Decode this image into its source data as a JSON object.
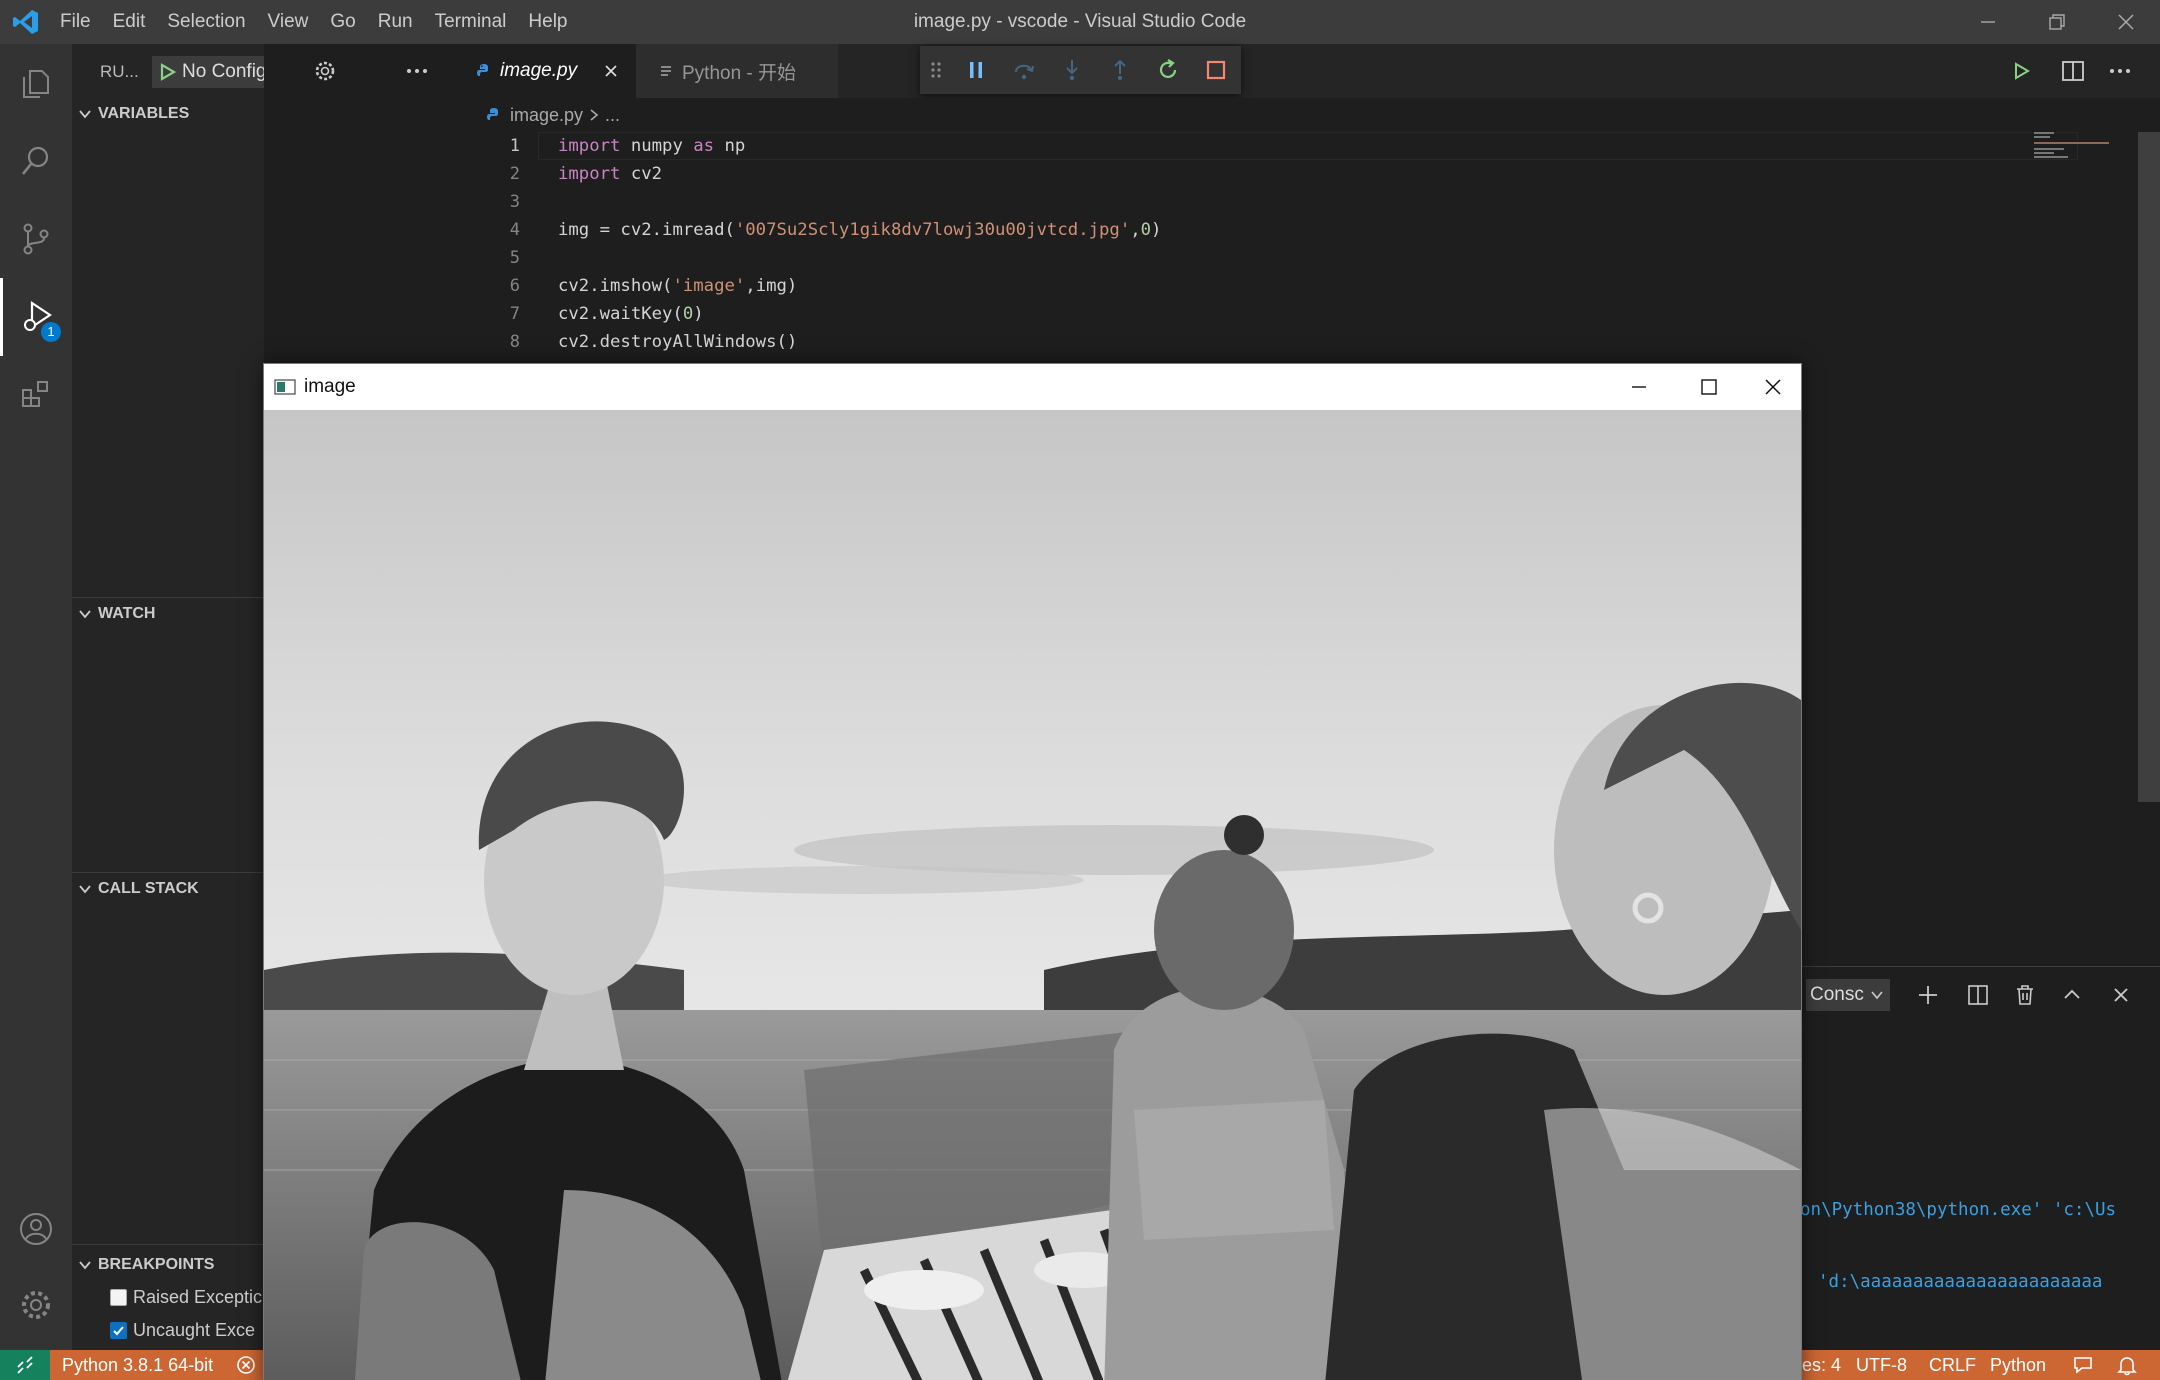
{
  "window": {
    "title": "image.py - vscode - Visual Studio Code"
  },
  "menu": [
    "File",
    "Edit",
    "Selection",
    "View",
    "Go",
    "Run",
    "Terminal",
    "Help"
  ],
  "activity": {
    "debug_badge": "1"
  },
  "run_view": {
    "title": "RU...",
    "config": "No Configurat",
    "sections": {
      "variables": "VARIABLES",
      "watch": "WATCH",
      "call_stack": "CALL STACK",
      "breakpoints": "BREAKPOINTS"
    },
    "breakpoints": [
      {
        "label": "Raised Exceptic",
        "checked": false
      },
      {
        "label": "Uncaught Exce",
        "checked": true
      }
    ]
  },
  "tabs": [
    {
      "label": "image.py",
      "active": true
    },
    {
      "label": "Python - 开始",
      "active": false
    }
  ],
  "breadcrumb": {
    "file": "image.py",
    "more": "..."
  },
  "editor": {
    "lines": [
      {
        "n": "1",
        "tokens": [
          {
            "t": "import",
            "c": "kw"
          },
          {
            "t": " numpy "
          },
          {
            "t": "as",
            "c": "kw"
          },
          {
            "t": " np"
          }
        ]
      },
      {
        "n": "2",
        "tokens": [
          {
            "t": "import",
            "c": "kw"
          },
          {
            "t": " cv2"
          }
        ]
      },
      {
        "n": "3",
        "tokens": []
      },
      {
        "n": "4",
        "tokens": [
          {
            "t": "img = cv2.imread("
          },
          {
            "t": "'007Su2Scly1gik8dv7lowj30u00jvtcd.jpg'",
            "c": "str"
          },
          {
            "t": ","
          },
          {
            "t": "0",
            "c": "num"
          },
          {
            "t": ")"
          }
        ]
      },
      {
        "n": "5",
        "tokens": []
      },
      {
        "n": "6",
        "tokens": [
          {
            "t": "cv2.imshow("
          },
          {
            "t": "'image'",
            "c": "str"
          },
          {
            "t": ",img)"
          }
        ]
      },
      {
        "n": "7",
        "tokens": [
          {
            "t": "cv2.waitKey("
          },
          {
            "t": "0",
            "c": "num"
          },
          {
            "t": ")"
          }
        ]
      },
      {
        "n": "8",
        "tokens": [
          {
            "t": "cv2.destroyAllWindows()"
          }
        ]
      }
    ]
  },
  "panel": {
    "dropdown": "Consc",
    "terminal_lines": [
      "on\\Python38\\python.exe' 'c:\\Us",
      "'d:\\aaaaaaaaaaaaaaaaaaaaaaa"
    ]
  },
  "statusbar": {
    "python": "Python 3.8.1 64-bit",
    "spaces": "es: 4",
    "encoding": "UTF-8",
    "eol": "CRLF",
    "language": "Python"
  },
  "image_window": {
    "title": "image"
  },
  "colors": {
    "statusbar": "#cc6633",
    "accent": "#007acc",
    "debug_green": "#89d185",
    "debug_blue": "#75beff",
    "stop_red": "#f48771"
  }
}
